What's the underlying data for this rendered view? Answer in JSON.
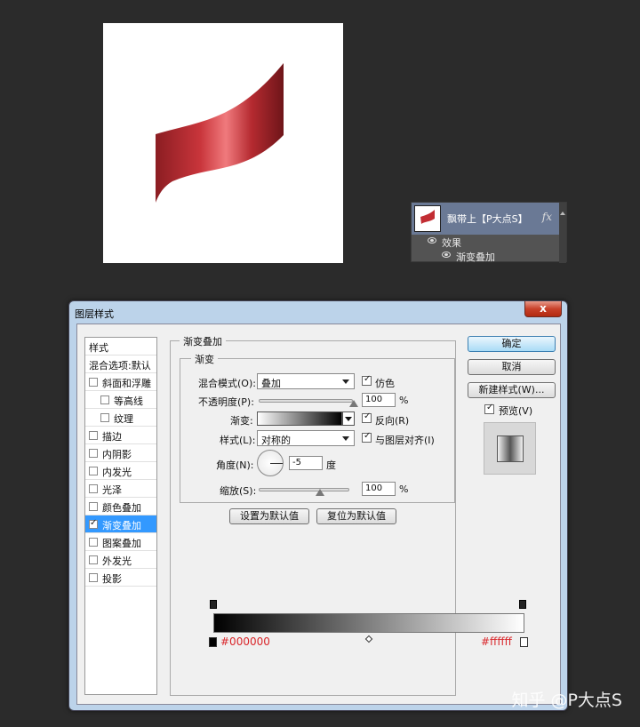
{
  "layers_panel": {
    "layer_name": "飘带上【P大点S】",
    "fx_label": "fx",
    "effects_label": "效果",
    "effect_item": "渐变叠加"
  },
  "dialog": {
    "title": "图层样式",
    "close_label": "x",
    "style_list": [
      {
        "label": "样式",
        "type": "header"
      },
      {
        "label": "混合选项:默认",
        "type": "header"
      },
      {
        "label": "斜面和浮雕",
        "checked": false
      },
      {
        "label": "等高线",
        "checked": false,
        "indent": true
      },
      {
        "label": "纹理",
        "checked": false,
        "indent": true
      },
      {
        "label": "描边",
        "checked": false
      },
      {
        "label": "内阴影",
        "checked": false
      },
      {
        "label": "内发光",
        "checked": false
      },
      {
        "label": "光泽",
        "checked": false
      },
      {
        "label": "颜色叠加",
        "checked": false
      },
      {
        "label": "渐变叠加",
        "checked": true,
        "selected": true
      },
      {
        "label": "图案叠加",
        "checked": false
      },
      {
        "label": "外发光",
        "checked": false
      },
      {
        "label": "投影",
        "checked": false
      }
    ],
    "group_title": "渐变叠加",
    "sub_title": "渐变",
    "blend_mode_label": "混合模式(O):",
    "blend_mode_value": "叠加",
    "dither_label": "仿色",
    "dither_checked": true,
    "opacity_label": "不透明度(P):",
    "opacity_value": "100",
    "opacity_unit": "%",
    "opacity_level": 1.0,
    "gradient_label": "渐变:",
    "reverse_label": "反向(R)",
    "reverse_checked": true,
    "style_label": "样式(L):",
    "style_value": "对称的",
    "align_label": "与图层对齐(I)",
    "align_checked": true,
    "angle_label": "角度(N):",
    "angle_value": "-5",
    "angle_unit": "度",
    "scale_label": "缩放(S):",
    "scale_value": "100",
    "scale_unit": "%",
    "scale_level": 0.667,
    "make_default_label": "设置为默认值",
    "reset_default_label": "复位为默认值",
    "ok_label": "确定",
    "cancel_label": "取消",
    "new_style_label": "新建样式(W)...",
    "preview_label": "预览(V)",
    "preview_checked": true
  },
  "gradient_editor": {
    "left_color": "#000000",
    "right_color": "#ffffff",
    "left_label": "#000000",
    "right_label": "#ffffff"
  },
  "watermark": "知乎 @P大点S",
  "colors": {
    "ribbon_dark": "#7a1a1f",
    "ribbon_light": "#f0767a",
    "selection": "#3399ff",
    "hex_label": "#d9262a"
  }
}
